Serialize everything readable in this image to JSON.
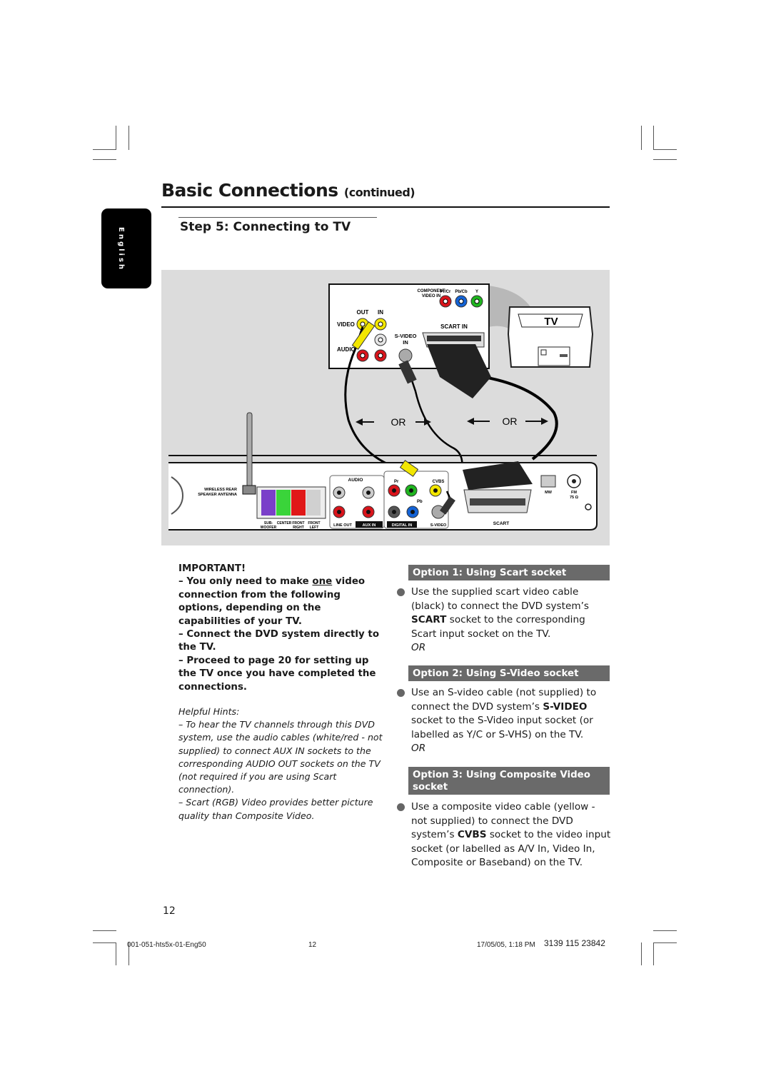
{
  "header": {
    "title": "Basic Connections",
    "title_suffix": "(continued)",
    "language_tab": "English"
  },
  "step": {
    "title": "Step 5:  Connecting to TV"
  },
  "diagram": {
    "tv_label": "TV",
    "tv_panel": {
      "component_label_1": "COMPONENT",
      "component_label_2": "VIDEO IN",
      "pr_label": "Pr/Cr",
      "pb_label": "Pb/Cb",
      "y_label": "Y",
      "out_label": "OUT",
      "in_label": "IN",
      "video_label": "VIDEO",
      "audio_label": "AUDIO",
      "svideo_label_1": "S-VIDEO",
      "svideo_label_2": "IN",
      "scart_label": "SCART IN",
      "colors": {
        "red": "#d9141b",
        "blue": "#1463d6",
        "green": "#1fb51f",
        "yellow": "#f2e600",
        "white": "#e6e6e6"
      }
    },
    "or_left": "OR",
    "or_right": "OR",
    "dvd_panel": {
      "antenna_label_1": "WIRELESS REAR",
      "antenna_label_2": "SPEAKER ANTENNA",
      "speaker_labels": [
        "SUB-",
        "WOOFER",
        "CENTER",
        "FRONT",
        "RIGHT",
        "FRONT",
        "LEFT"
      ],
      "speaker_colors": [
        "#7a3fc9",
        "#3ad43a",
        "#e01818",
        "#d0d0d0"
      ],
      "audio_label": "AUDIO",
      "line_out_label": "LINE OUT",
      "aux_in_label": "AUX IN",
      "digital_in_label": "DIGITAL IN",
      "pr_label": "Pr",
      "pb_label": "Pb",
      "cvbs_label": "CVBS",
      "svideo_label": "S-VIDEO",
      "scart_label": "SCART",
      "mw_label": "MW",
      "fm_label_1": "FM",
      "fm_label_2": "75 Ω"
    }
  },
  "important": {
    "heading": "IMPORTANT!",
    "item1_pre": "–  You only need to make ",
    "item1_underline": "one",
    "item1_post": " video connection from the following options, depending on the capabilities of your TV.",
    "item2": "–  Connect the DVD system directly to the TV.",
    "item3": "–  Proceed to page 20 for setting up the TV once you have completed the connections."
  },
  "hints": {
    "heading": "Helpful Hints:",
    "hint1": "–  To hear the TV channels through this DVD system, use the audio cables (white/red - not supplied) to connect AUX IN sockets to the corresponding AUDIO OUT sockets on the TV (not required if you are using Scart connection).",
    "hint2": "–  Scart (RGB) Video provides better picture quality than Composite Video."
  },
  "options": [
    {
      "heading": "Option 1: Using Scart socket",
      "text_pre": "Use the supplied scart video cable (black) to connect the DVD system’s ",
      "text_bold": "SCART",
      "text_post": " socket to the corresponding Scart input socket on the TV.",
      "or": "OR"
    },
    {
      "heading": "Option 2: Using S-Video socket",
      "text_pre": "Use an S-video cable (not supplied) to connect the DVD system’s ",
      "text_bold": "S-VIDEO",
      "text_post": " socket to the S-Video input socket (or labelled as Y/C or S-VHS) on the TV.",
      "or": "OR"
    },
    {
      "heading": "Option 3: Using Composite Video socket",
      "text_pre": "Use a composite video cable (yellow - not supplied) to connect the DVD system’s ",
      "text_bold": "CVBS",
      "text_post": " socket to the video input socket (or labelled as A/V In, Video In, Composite or Baseband) on the TV."
    }
  ],
  "page_number": "12",
  "footer": {
    "file": "001-051-hts5x-01-Eng50",
    "page": "12",
    "date": "17/05/05, 1:18 PM",
    "code": "3139 115 23842"
  }
}
